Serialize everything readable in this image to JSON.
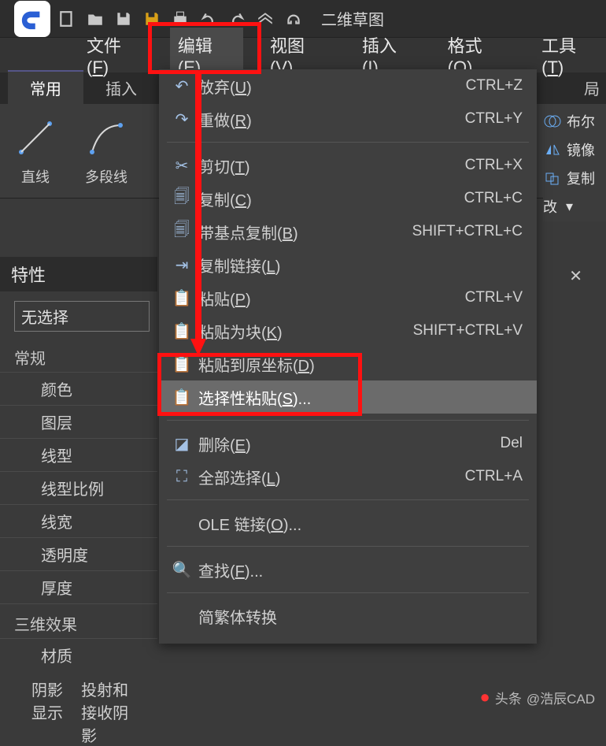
{
  "titlebar": {
    "tab_name": "二维草图"
  },
  "menu": {
    "items": [
      {
        "label": "文件",
        "mnemonic": "F"
      },
      {
        "label": "编辑",
        "mnemonic": "E"
      },
      {
        "label": "视图",
        "mnemonic": "V"
      },
      {
        "label": "插入",
        "mnemonic": "I"
      },
      {
        "label": "格式",
        "mnemonic": "O"
      },
      {
        "label": "工具",
        "mnemonic": "T"
      }
    ]
  },
  "ribbon_tabs": {
    "items": [
      {
        "label": "常用"
      },
      {
        "label": "插入"
      },
      {
        "label": "布局",
        "clipped": true
      },
      {
        "label": "局",
        "trailing": true
      }
    ]
  },
  "ribbon_tools": {
    "line": "直线",
    "polyline": "多段线"
  },
  "ribbon_right": {
    "boolean": "布尔",
    "mirror": "镜像",
    "copy": "复制",
    "modify": "改"
  },
  "edit_menu": {
    "undo": {
      "label": "放弃",
      "mnemonic": "U",
      "shortcut": "CTRL+Z"
    },
    "redo": {
      "label": "重做",
      "mnemonic": "R",
      "shortcut": "CTRL+Y"
    },
    "cut": {
      "label": "剪切",
      "mnemonic": "T",
      "shortcut": "CTRL+X"
    },
    "copy": {
      "label": "复制",
      "mnemonic": "C",
      "shortcut": "CTRL+C"
    },
    "copybase": {
      "label": "带基点复制",
      "mnemonic": "B",
      "shortcut": "SHIFT+CTRL+C"
    },
    "copylink": {
      "label": "复制链接",
      "mnemonic": "L",
      "shortcut": ""
    },
    "paste": {
      "label": "粘贴",
      "mnemonic": "P",
      "shortcut": "CTRL+V"
    },
    "pasteblk": {
      "label": "粘贴为块",
      "mnemonic": "K",
      "shortcut": "SHIFT+CTRL+V"
    },
    "pasteorig": {
      "label": "粘贴到原坐标",
      "mnemonic": "D",
      "shortcut": ""
    },
    "pastespec": {
      "label": "选择性粘贴",
      "mnemonic": "S",
      "shortcut": "",
      "hover": true,
      "ellipsis": true
    },
    "delete": {
      "label": "删除",
      "mnemonic": "E",
      "shortcut": "Del"
    },
    "selall": {
      "label": "全部选择",
      "mnemonic": "L",
      "shortcut": "CTRL+A"
    },
    "olelink": {
      "label": "OLE 链接",
      "mnemonic": "O",
      "shortcut": "",
      "ellipsis": true
    },
    "find": {
      "label": "查找",
      "mnemonic": "F",
      "shortcut": "",
      "ellipsis": true
    },
    "trad": {
      "label": "简繁体转换"
    }
  },
  "props": {
    "title": "特性",
    "no_selection": "无选择",
    "general": "常规",
    "rows": {
      "color": "颜色",
      "layer": "图层",
      "ltype": "线型",
      "lscale": "线型比例",
      "lweight": "线宽",
      "transp": "透明度",
      "thick": "厚度"
    },
    "threed": "三维效果",
    "material": "材质",
    "shadow": {
      "label": "阴影显示",
      "value": "投射和接收阴影"
    }
  },
  "watermark": {
    "prefix": "头条",
    "author": "@浩辰CAD"
  }
}
